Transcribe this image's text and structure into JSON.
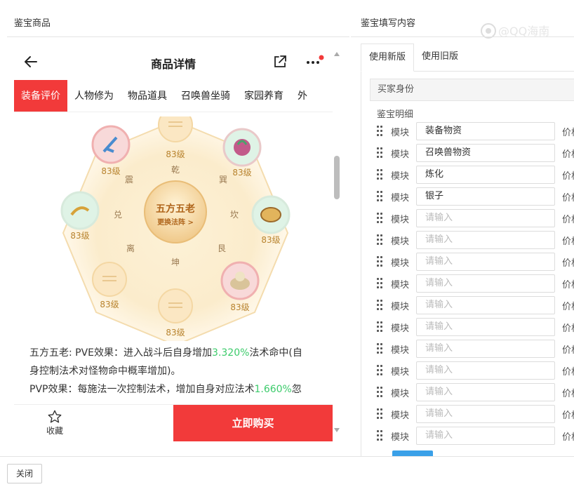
{
  "left_header": {
    "title": "鉴宝商品"
  },
  "right_header": {
    "title": "鉴宝填写内容"
  },
  "watermark": {
    "text": "@QQ海南"
  },
  "phone": {
    "title": "商品详情",
    "tabs": [
      "装备评价",
      "人物修为",
      "物品道具",
      "召唤兽坐骑",
      "家园养育",
      "外"
    ],
    "formation": {
      "center_title": "五方五老",
      "center_sub": "更换法阵 >",
      "directions": [
        "乾",
        "巽",
        "坎",
        "艮",
        "坤",
        "离",
        "兑",
        "震"
      ],
      "slots": [
        "83级",
        "83级",
        "83级",
        "83级",
        "83级",
        "83级",
        "83级",
        "83级"
      ]
    },
    "desc": {
      "l1_a": "五方五老: PVE效果：进入战斗后自身增加",
      "l1_g": "3.320%",
      "l1_b": "法术命中(自",
      "l2": "身控制法术对怪物命中概率增加)。",
      "l3_a": "PVP效果：每施法一次控制法术，增加自身对应法术",
      "l3_g": "1.660%",
      "l3_b": "忽"
    },
    "bottom": {
      "fav_label": "收藏",
      "buy_label": "立即购买"
    }
  },
  "right": {
    "tabs": [
      "使用新版",
      "使用旧版"
    ],
    "buyer_identity": "买家身份",
    "detail_label": "鉴宝明细",
    "module_label": "模块",
    "price_label": "价格",
    "placeholder": "请输入",
    "rows": [
      {
        "value": "装备物资"
      },
      {
        "value": "召唤兽物资"
      },
      {
        "value": "炼化"
      },
      {
        "value": "银子"
      },
      {
        "value": ""
      },
      {
        "value": ""
      },
      {
        "value": ""
      },
      {
        "value": ""
      },
      {
        "value": ""
      },
      {
        "value": ""
      },
      {
        "value": ""
      },
      {
        "value": ""
      },
      {
        "value": ""
      },
      {
        "value": ""
      },
      {
        "value": ""
      }
    ]
  },
  "footer": {
    "close_label": "关闭"
  },
  "colors": {
    "accent_red": "#f23a3a",
    "green_value": "#3ccb6b",
    "add_blue": "#3aa0e8"
  }
}
